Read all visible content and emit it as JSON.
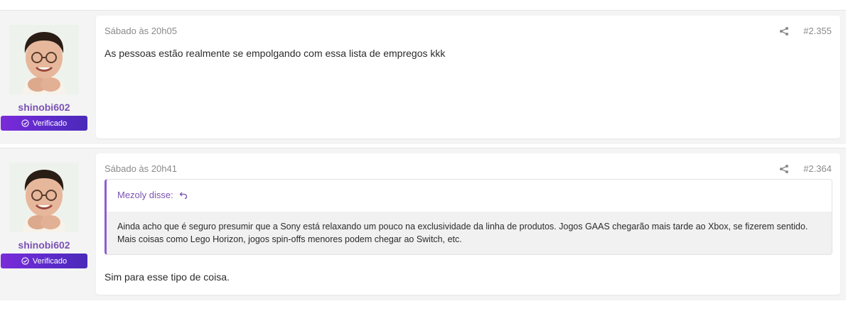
{
  "posts": [
    {
      "username": "shinobi602",
      "badge": "Verificado",
      "date": "Sábado às 20h05",
      "post_number": "#2.355",
      "message": "As pessoas estão realmente se empolgando com essa lista de empregos kkk"
    },
    {
      "username": "shinobi602",
      "badge": "Verificado",
      "date": "Sábado às 20h41",
      "post_number": "#2.364",
      "quote": {
        "author": "Mezoly disse:",
        "text": "Ainda acho que é seguro presumir que a Sony está relaxando um pouco na exclusividade da linha de produtos. Jogos GAAS chegarão mais tarde ao Xbox, se fizerem sentido. Mais coisas como Lego Horizon, jogos spin-offs menores podem chegar ao Switch, etc."
      },
      "message": "Sim para esse tipo de coisa."
    }
  ],
  "colors": {
    "username": "#7a52b3",
    "badge_start": "#7a2bd9",
    "badge_end": "#4b2ab8",
    "quote_border": "#8f5ed0"
  }
}
